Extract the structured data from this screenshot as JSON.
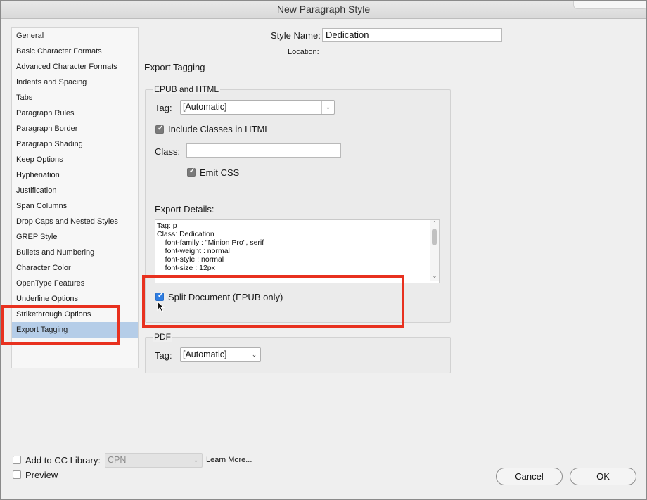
{
  "window": {
    "title": "New Paragraph Style"
  },
  "sidebar": {
    "items": [
      {
        "label": "General"
      },
      {
        "label": "Basic Character Formats"
      },
      {
        "label": "Advanced Character Formats"
      },
      {
        "label": "Indents and Spacing"
      },
      {
        "label": "Tabs"
      },
      {
        "label": "Paragraph Rules"
      },
      {
        "label": "Paragraph Border"
      },
      {
        "label": "Paragraph Shading"
      },
      {
        "label": "Keep Options"
      },
      {
        "label": "Hyphenation"
      },
      {
        "label": "Justification"
      },
      {
        "label": "Span Columns"
      },
      {
        "label": "Drop Caps and Nested Styles"
      },
      {
        "label": "GREP Style"
      },
      {
        "label": "Bullets and Numbering"
      },
      {
        "label": "Character Color"
      },
      {
        "label": "OpenType Features"
      },
      {
        "label": "Underline Options"
      },
      {
        "label": "Strikethrough Options"
      },
      {
        "label": "Export Tagging"
      }
    ],
    "selected": "Export Tagging"
  },
  "header": {
    "style_name_label": "Style Name:",
    "style_name_value": "Dedication",
    "location_label": "Location:"
  },
  "section_title": "Export Tagging",
  "epub": {
    "group_title": "EPUB and HTML",
    "tag_label": "Tag:",
    "tag_value": "[Automatic]",
    "include_classes_label": "Include Classes in HTML",
    "include_classes_checked": true,
    "class_label": "Class:",
    "class_value": "",
    "emit_css_label": "Emit CSS",
    "emit_css_checked": true,
    "export_details_label": "Export Details:",
    "export_details_lines": [
      "Tag: p",
      "Class: Dedication",
      "    font-family : \"Minion Pro\", serif",
      "    font-weight : normal",
      "    font-style : normal",
      "    font-size : 12px"
    ],
    "split_document_label": "Split Document (EPUB only)",
    "split_document_checked": true
  },
  "pdf": {
    "group_title": "PDF",
    "tag_label": "Tag:",
    "tag_value": "[Automatic]"
  },
  "footer": {
    "add_to_cc_label": "Add to CC Library:",
    "add_to_cc_checked": false,
    "cc_library_value": "CPN",
    "learn_more_label": "Learn More...",
    "preview_label": "Preview",
    "preview_checked": false,
    "cancel_label": "Cancel",
    "ok_label": "OK"
  },
  "colors": {
    "highlight": "#e8311f",
    "selection": "#b5cde8",
    "checkbox_blue": "#2f7de1"
  }
}
